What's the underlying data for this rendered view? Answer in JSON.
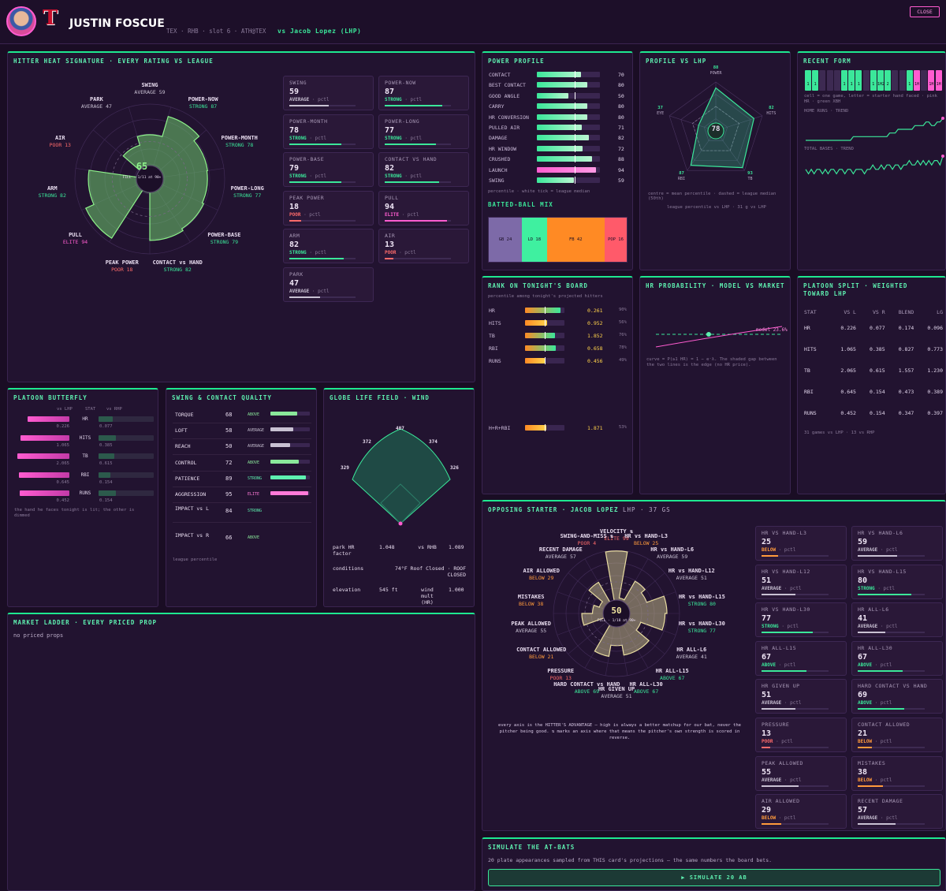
{
  "header": {
    "team_letter": "T",
    "player": "JUSTIN FOSCUE",
    "meta": "TEX · RHB · slot 6 · ATH@TEX",
    "vs": "vs Jacob Lopez (LHP)",
    "close": "CLOSE"
  },
  "heat": {
    "title": "HITTER HEAT SIGNATURE · EVERY RATING VS LEAGUE",
    "center_value": "65",
    "center_sub": "FILL · 1/11 at 90+",
    "axes": [
      {
        "name": "SWING",
        "tier": "AVERAGE 59",
        "v": 59,
        "cls": "gray"
      },
      {
        "name": "POWER-NOW",
        "tier": "STRONG 87",
        "v": 87,
        "cls": "green"
      },
      {
        "name": "POWER-MONTH",
        "tier": "STRONG 78",
        "v": 78,
        "cls": "green"
      },
      {
        "name": "POWER-LONG",
        "tier": "STRONG 77",
        "v": 77,
        "cls": "green"
      },
      {
        "name": "POWER-BASE",
        "tier": "STRONG 79",
        "v": 79,
        "cls": "green"
      },
      {
        "name": "CONTACT vs HAND",
        "tier": "STRONG 82",
        "v": 82,
        "cls": "green"
      },
      {
        "name": "PEAK POWER",
        "tier": "POOR 18",
        "v": 18,
        "cls": "red"
      },
      {
        "name": "PULL",
        "tier": "ELITE 94",
        "v": 94,
        "cls": "pink"
      },
      {
        "name": "ARM",
        "tier": "STRONG 82",
        "v": 82,
        "cls": "green"
      },
      {
        "name": "AIR",
        "tier": "POOR 13",
        "v": 13,
        "cls": "red"
      },
      {
        "name": "PARK",
        "tier": "AVERAGE 47",
        "v": 47,
        "cls": "gray"
      }
    ],
    "cards": [
      {
        "t": "SWING",
        "v": "59",
        "s": "AVERAGE",
        "p": "· pctl",
        "cls": "gray",
        "f": 59
      },
      {
        "t": "POWER-NOW",
        "v": "87",
        "s": "STRONG",
        "p": "· pctl",
        "cls": "green",
        "f": 87
      },
      {
        "t": "POWER-MONTH",
        "v": "78",
        "s": "STRONG",
        "p": "· pctl",
        "cls": "green",
        "f": 78
      },
      {
        "t": "POWER-LONG",
        "v": "77",
        "s": "STRONG",
        "p": "· pctl",
        "cls": "green",
        "f": 77
      },
      {
        "t": "POWER-BASE",
        "v": "79",
        "s": "STRONG",
        "p": "· pctl",
        "cls": "green",
        "f": 79
      },
      {
        "t": "CONTACT vs HAND",
        "v": "82",
        "s": "STRONG",
        "p": "· pctl",
        "cls": "green",
        "f": 82
      },
      {
        "t": "PEAK POWER",
        "v": "18",
        "s": "POOR",
        "p": "· pctl",
        "cls": "red",
        "f": 18
      },
      {
        "t": "PULL",
        "v": "94",
        "s": "ELITE",
        "p": "· pctl",
        "cls": "pink",
        "f": 94
      },
      {
        "t": "ARM",
        "v": "82",
        "s": "STRONG",
        "p": "· pctl",
        "cls": "green",
        "f": 82
      },
      {
        "t": "AIR",
        "v": "13",
        "s": "POOR",
        "p": "· pctl",
        "cls": "red",
        "f": 13
      },
      {
        "t": "PARK",
        "v": "47",
        "s": "AVERAGE",
        "p": "· pctl",
        "cls": "gray",
        "f": 47
      }
    ]
  },
  "power": {
    "title": "POWER PROFILE",
    "rows": [
      {
        "n": "CONTACT",
        "v": 70
      },
      {
        "n": "BEST CONTACT",
        "v": 80
      },
      {
        "n": "GOOD ANGLE",
        "v": 50
      },
      {
        "n": "CARRY",
        "v": 80
      },
      {
        "n": "HR CONVERSION",
        "v": 80
      },
      {
        "n": "PULLED AIR",
        "v": 71
      },
      {
        "n": "DAMAGE",
        "v": 82
      },
      {
        "n": "HR WINDOW",
        "v": 72
      },
      {
        "n": "CRUSHED",
        "v": 88
      },
      {
        "n": "LAUNCH",
        "v": 94
      },
      {
        "n": "SWING",
        "v": 59
      }
    ],
    "note": "percentile · white tick = league median",
    "bb_title": "BATTED-BALL MIX",
    "bb": [
      {
        "n": "GB 24",
        "v": 24,
        "c": "#7d6aa8"
      },
      {
        "n": "LD 18",
        "v": 18,
        "c": "#3ff0a0"
      },
      {
        "n": "FB 42",
        "v": 42,
        "c": "#ff8a24"
      },
      {
        "n": "POP 16",
        "v": 16,
        "c": "#ff5a6a"
      }
    ]
  },
  "profile": {
    "title": "PROFILE vs LHP",
    "center": "78",
    "axes": [
      {
        "n": "POWER",
        "v": 88
      },
      {
        "n": "HITS",
        "v": 82
      },
      {
        "n": "TB",
        "v": 93
      },
      {
        "n": "RBI",
        "v": 87
      },
      {
        "n": "EYE",
        "v": 37
      }
    ],
    "note1": "centre = mean percentile · dashed = league median (50th)",
    "note2": "league percentile vs LHP · 31 g vs LHP"
  },
  "form": {
    "title": "RECENT FORM",
    "games": [
      {
        "t": "1",
        "c": "g"
      },
      {
        "t": "1",
        "c": "g"
      },
      {
        "t": "",
        "c": "d"
      },
      {
        "t": "",
        "c": "d"
      },
      {
        "t": "",
        "c": "d"
      },
      {
        "t": "1",
        "c": "g"
      },
      {
        "t": "1",
        "c": "g"
      },
      {
        "t": "1",
        "c": "g"
      },
      {
        "t": "",
        "c": "d"
      },
      {
        "t": "1",
        "c": "g"
      },
      {
        "t": "1H2",
        "c": "g"
      },
      {
        "t": "2",
        "c": "g"
      },
      {
        "t": "",
        "c": "d"
      },
      {
        "t": "",
        "c": "d"
      },
      {
        "t": "1",
        "c": "g"
      },
      {
        "t": "1H",
        "c": "p"
      },
      {
        "t": "",
        "c": "d"
      },
      {
        "t": "1H",
        "c": "p"
      },
      {
        "t": "1H",
        "c": "p"
      }
    ],
    "legend": "cell = one game, letter = starter hand faced · pink HR · green XBH",
    "hr_label": "HOME RUNS · TREND",
    "tb_label": "TOTAL BASES · TREND",
    "hr_series": [
      0,
      0,
      0,
      0,
      0,
      0,
      0,
      0,
      0,
      0,
      0,
      0,
      0,
      0,
      0,
      0,
      0,
      1,
      1,
      1,
      1,
      1,
      1,
      1,
      1,
      1,
      1,
      1,
      1,
      1,
      2,
      2,
      2,
      3,
      3,
      3,
      3,
      3,
      3,
      4,
      4,
      4,
      4,
      5,
      5,
      4,
      4,
      5,
      5,
      6
    ],
    "tb_series": [
      2,
      1,
      2,
      1,
      2,
      2,
      1,
      2,
      1,
      2,
      2,
      1,
      2,
      2,
      1,
      2,
      2,
      1,
      2,
      2,
      2,
      1,
      2,
      2,
      3,
      2,
      2,
      3,
      2,
      3,
      3,
      2,
      3,
      3,
      2,
      3,
      3,
      4,
      3,
      3,
      4,
      3,
      4,
      3,
      4,
      3,
      4,
      4,
      3,
      5
    ]
  },
  "rank": {
    "title": "RANK ON TONIGHT'S BOARD",
    "sub": "percentile among tonight's projected hitters",
    "rows": [
      {
        "n": "HR",
        "v": "0.261",
        "p": "90%",
        "f": 90
      },
      {
        "n": "HITS",
        "v": "0.952",
        "p": "56%",
        "f": 56
      },
      {
        "n": "TB",
        "v": "1.852",
        "p": "76%",
        "f": 76
      },
      {
        "n": "RBI",
        "v": "0.658",
        "p": "78%",
        "f": 78
      },
      {
        "n": "RUNS",
        "v": "0.456",
        "p": "49%",
        "f": 49
      }
    ],
    "combo": {
      "n": "H+R+RBI",
      "v": "1.871",
      "p": "53%",
      "f": 53
    }
  },
  "hrprob": {
    "title": "HR PROBABILITY · MODEL VS MARKET",
    "model": "model 23.6%",
    "note": "curve = P(≥1 HR) = 1 − e⁻λ. The shaded gap between the two lines is the edge (no HR price)."
  },
  "platoon": {
    "title": "PLATOON SPLIT · WEIGHTED TOWARD LHP",
    "head": [
      "STAT",
      "VS L",
      "VS R",
      "BLEND",
      "LG"
    ],
    "rows": [
      [
        "HR",
        "0.226",
        "0.077",
        "0.174",
        "0.096"
      ],
      [
        "HITS",
        "1.065",
        "0.385",
        "0.827",
        "0.773"
      ],
      [
        "TB",
        "2.065",
        "0.615",
        "1.557",
        "1.230"
      ],
      [
        "RBI",
        "0.645",
        "0.154",
        "0.473",
        "0.389"
      ],
      [
        "RUNS",
        "0.452",
        "0.154",
        "0.347",
        "0.397"
      ]
    ],
    "note": "31 games vs LHP · 13 vs RHP"
  },
  "butterfly": {
    "title": "PLATOON BUTTERFLY",
    "h_l": "vs LHP",
    "h_s": "STAT",
    "h_r": "vs RHP",
    "rows": [
      {
        "s": "HR",
        "l": "0.226",
        "r": "0.077",
        "lf": 0.226,
        "rf": 0.077,
        "max": 0.3
      },
      {
        "s": "HITS",
        "l": "1.065",
        "r": "0.385",
        "lf": 1.065,
        "rf": 0.385,
        "max": 1.2
      },
      {
        "s": "TB",
        "l": "2.065",
        "r": "0.615",
        "lf": 2.065,
        "rf": 0.615,
        "max": 2.2
      },
      {
        "s": "RBI",
        "l": "0.645",
        "r": "0.154",
        "lf": 0.645,
        "rf": 0.154,
        "max": 0.7
      },
      {
        "s": "RUNS",
        "l": "0.452",
        "r": "0.154",
        "lf": 0.452,
        "rf": 0.154,
        "max": 0.5
      }
    ],
    "note": "the hand he faces tonight is lit; the other is dimmed"
  },
  "swing": {
    "title": "SWING & CONTACT QUALITY",
    "rows": [
      {
        "n": "TORQUE",
        "v": "68",
        "t": "ABOVE",
        "f": 68,
        "c": "#8ae89a"
      },
      {
        "n": "LOFT",
        "v": "58",
        "t": "AVERAGE",
        "f": 58,
        "c": "#c8c1d2"
      },
      {
        "n": "REACH",
        "v": "50",
        "t": "AVERAGE",
        "f": 50,
        "c": "#c8c1d2"
      },
      {
        "n": "CONTROL",
        "v": "72",
        "t": "ABOVE",
        "f": 72,
        "c": "#8ae89a"
      },
      {
        "n": "PATIENCE",
        "v": "89",
        "t": "STRONG",
        "f": 89,
        "c": "#5ef0b0"
      },
      {
        "n": "AGGRESSION",
        "v": "95",
        "t": "ELITE",
        "f": 95,
        "c": "#ff7ad8"
      },
      {
        "n": "IMPACT vs L",
        "v": "84",
        "t": "STRONG",
        "f": 84,
        "c": "#5ef0b0"
      },
      {
        "n": "IMPACT vs R",
        "v": "66",
        "t": "ABOVE",
        "f": 66,
        "c": "#8ae89a"
      }
    ],
    "note": "league percentile"
  },
  "park": {
    "title": "GLOBE LIFE FIELD · WIND",
    "dims": {
      "lf": "329",
      "lc": "372",
      "cf": "407",
      "rc": "374",
      "rf": "326"
    },
    "rows": [
      {
        "a": "park HR factor",
        "b": "1.048",
        "c": "vs RHB",
        "d": "1.089"
      },
      {
        "a": "conditions",
        "b": "74°F Roof Closed · ROOF CLOSED",
        "c": "",
        "d": ""
      },
      {
        "a": "elevation",
        "b": "545 ft",
        "c": "wind mult (HR)",
        "d": "1.000"
      }
    ]
  },
  "market": {
    "title": "MARKET LADDER · EVERY PRICED PROP",
    "empty": "no priced props"
  },
  "opp": {
    "title": "OPPOSING STARTER · JACOB LOPEZ",
    "hand": "LHP · 37 GS",
    "center": "50",
    "center_sub": "FILL · 1/18 at 90+",
    "axes": [
      {
        "n": "VELOCITY ⇅",
        "t": "ELITE 99",
        "v": 99,
        "c": "red"
      },
      {
        "n": "HR vs HAND-L3",
        "t": "BELOW 25",
        "v": 25,
        "c": "orange"
      },
      {
        "n": "HR vs HAND-L6",
        "t": "AVERAGE 59",
        "v": 59,
        "c": "gray"
      },
      {
        "n": "HR vs HAND-L12",
        "t": "AVERAGE 51",
        "v": 51,
        "c": "gray"
      },
      {
        "n": "HR vs HAND-L15",
        "t": "STRONG 80",
        "v": 80,
        "c": "green"
      },
      {
        "n": "HR vs HAND-L30",
        "t": "STRONG 77",
        "v": 77,
        "c": "green"
      },
      {
        "n": "HR ALL-L6",
        "t": "AVERAGE 41",
        "v": 41,
        "c": "gray"
      },
      {
        "n": "HR ALL-L15",
        "t": "ABOVE 67",
        "v": 67,
        "c": "green"
      },
      {
        "n": "HR ALL-L30",
        "t": "ABOVE 67",
        "v": 67,
        "c": "green"
      },
      {
        "n": "HR GIVEN UP",
        "t": "AVERAGE 51",
        "v": 51,
        "c": "gray"
      },
      {
        "n": "HARD CONTACT vs HAND",
        "t": "ABOVE 69",
        "v": 69,
        "c": "green"
      },
      {
        "n": "PRESSURE",
        "t": "POOR 13",
        "v": 13,
        "c": "red"
      },
      {
        "n": "CONTACT ALLOWED",
        "t": "BELOW 21",
        "v": 21,
        "c": "orange"
      },
      {
        "n": "PEAK ALLOWED",
        "t": "AVERAGE 55",
        "v": 55,
        "c": "gray"
      },
      {
        "n": "MISTAKES",
        "t": "BELOW 38",
        "v": 38,
        "c": "orange"
      },
      {
        "n": "AIR ALLOWED",
        "t": "BELOW 29",
        "v": 29,
        "c": "orange"
      },
      {
        "n": "RECENT DAMAGE",
        "t": "AVERAGE 57",
        "v": 57,
        "c": "gray"
      },
      {
        "n": "SWING-AND-MISS ⇅",
        "t": "POOR 4",
        "v": 4,
        "c": "red"
      }
    ],
    "note": "every axis is the HITTER'S ADVANTAGE — high is always a better matchup for our bat, never the pitcher being good. ⇅ marks an axis where that means the pitcher's own strength is scored in reverse.",
    "cards": [
      {
        "t": "HR vs HAND-L3",
        "v": "25",
        "s": "BELOW",
        "cls": "orange",
        "f": 25
      },
      {
        "t": "HR vs HAND-L6",
        "v": "59",
        "s": "AVERAGE",
        "cls": "gray",
        "f": 59
      },
      {
        "t": "HR vs HAND-L12",
        "v": "51",
        "s": "AVERAGE",
        "cls": "gray",
        "f": 51
      },
      {
        "t": "HR vs HAND-L15",
        "v": "80",
        "s": "STRONG",
        "cls": "green",
        "f": 80
      },
      {
        "t": "HR vs HAND-L30",
        "v": "77",
        "s": "STRONG",
        "cls": "green",
        "f": 77
      },
      {
        "t": "HR ALL-L6",
        "v": "41",
        "s": "AVERAGE",
        "cls": "gray",
        "f": 41
      },
      {
        "t": "HR ALL-L15",
        "v": "67",
        "s": "ABOVE",
        "cls": "green",
        "f": 67
      },
      {
        "t": "HR ALL-L30",
        "v": "67",
        "s": "ABOVE",
        "cls": "green",
        "f": 67
      },
      {
        "t": "HR GIVEN UP",
        "v": "51",
        "s": "AVERAGE",
        "cls": "gray",
        "f": 51
      },
      {
        "t": "HARD CONTACT vs HAND",
        "v": "69",
        "s": "ABOVE",
        "cls": "green",
        "f": 69
      },
      {
        "t": "PRESSURE",
        "v": "13",
        "s": "POOR",
        "cls": "red",
        "f": 13
      },
      {
        "t": "CONTACT ALLOWED",
        "v": "21",
        "s": "BELOW",
        "cls": "orange",
        "f": 21
      },
      {
        "t": "PEAK ALLOWED",
        "v": "55",
        "s": "AVERAGE",
        "cls": "gray",
        "f": 55
      },
      {
        "t": "MISTAKES",
        "v": "38",
        "s": "BELOW",
        "cls": "orange",
        "f": 38
      },
      {
        "t": "AIR ALLOWED",
        "v": "29",
        "s": "BELOW",
        "cls": "orange",
        "f": 29
      },
      {
        "t": "RECENT DAMAGE",
        "v": "57",
        "s": "AVERAGE",
        "cls": "gray",
        "f": 57
      }
    ]
  },
  "sim": {
    "title": "SIMULATE THE AT-BATS",
    "sub": "20 plate appearances sampled from THIS card's projections — the same numbers the board bets.",
    "button": "▶ SIMULATE 20 AB"
  }
}
